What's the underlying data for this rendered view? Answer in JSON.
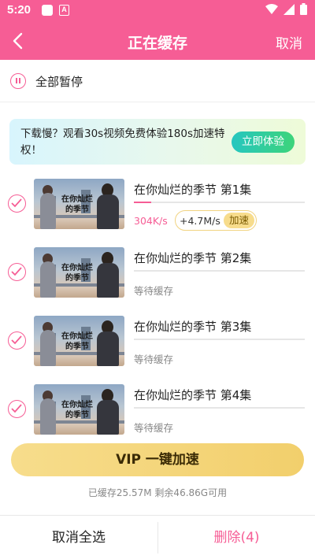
{
  "status_bar": {
    "time": "5:20"
  },
  "header": {
    "title": "正在缓存",
    "cancel_label": "取消"
  },
  "pause_all": {
    "label": "全部暂停"
  },
  "promo": {
    "text": "下载慢？观看30s视频免费体验180s加速特权！",
    "button_label": "立即体验"
  },
  "thumbnail_caption": [
    "在你灿烂",
    "的季节"
  ],
  "downloads": [
    {
      "title": "在你灿烂的季节 第1集",
      "progress": 0.1,
      "speed": "304K/s",
      "boost_speed": "+4.7M/s",
      "boost_label": "加速",
      "status": ""
    },
    {
      "title": "在你灿烂的季节 第2集",
      "progress": 0,
      "speed": "",
      "boost_speed": "",
      "boost_label": "",
      "status": "等待缓存"
    },
    {
      "title": "在你灿烂的季节 第3集",
      "progress": 0,
      "speed": "",
      "boost_speed": "",
      "boost_label": "",
      "status": "等待缓存"
    },
    {
      "title": "在你灿烂的季节 第4集",
      "progress": 0,
      "speed": "",
      "boost_speed": "",
      "boost_label": "",
      "status": "等待缓存"
    }
  ],
  "vip_button": {
    "label": "VIP 一键加速"
  },
  "storage": {
    "text": "已缓存25.57M 剩余46.86G可用"
  },
  "bottom": {
    "cancel_all_label": "取消全选",
    "delete_label": "删除(4)"
  },
  "colors": {
    "accent": "#f65d95",
    "gold": "#f2cf6c",
    "promo_button": "#26c6c0"
  }
}
